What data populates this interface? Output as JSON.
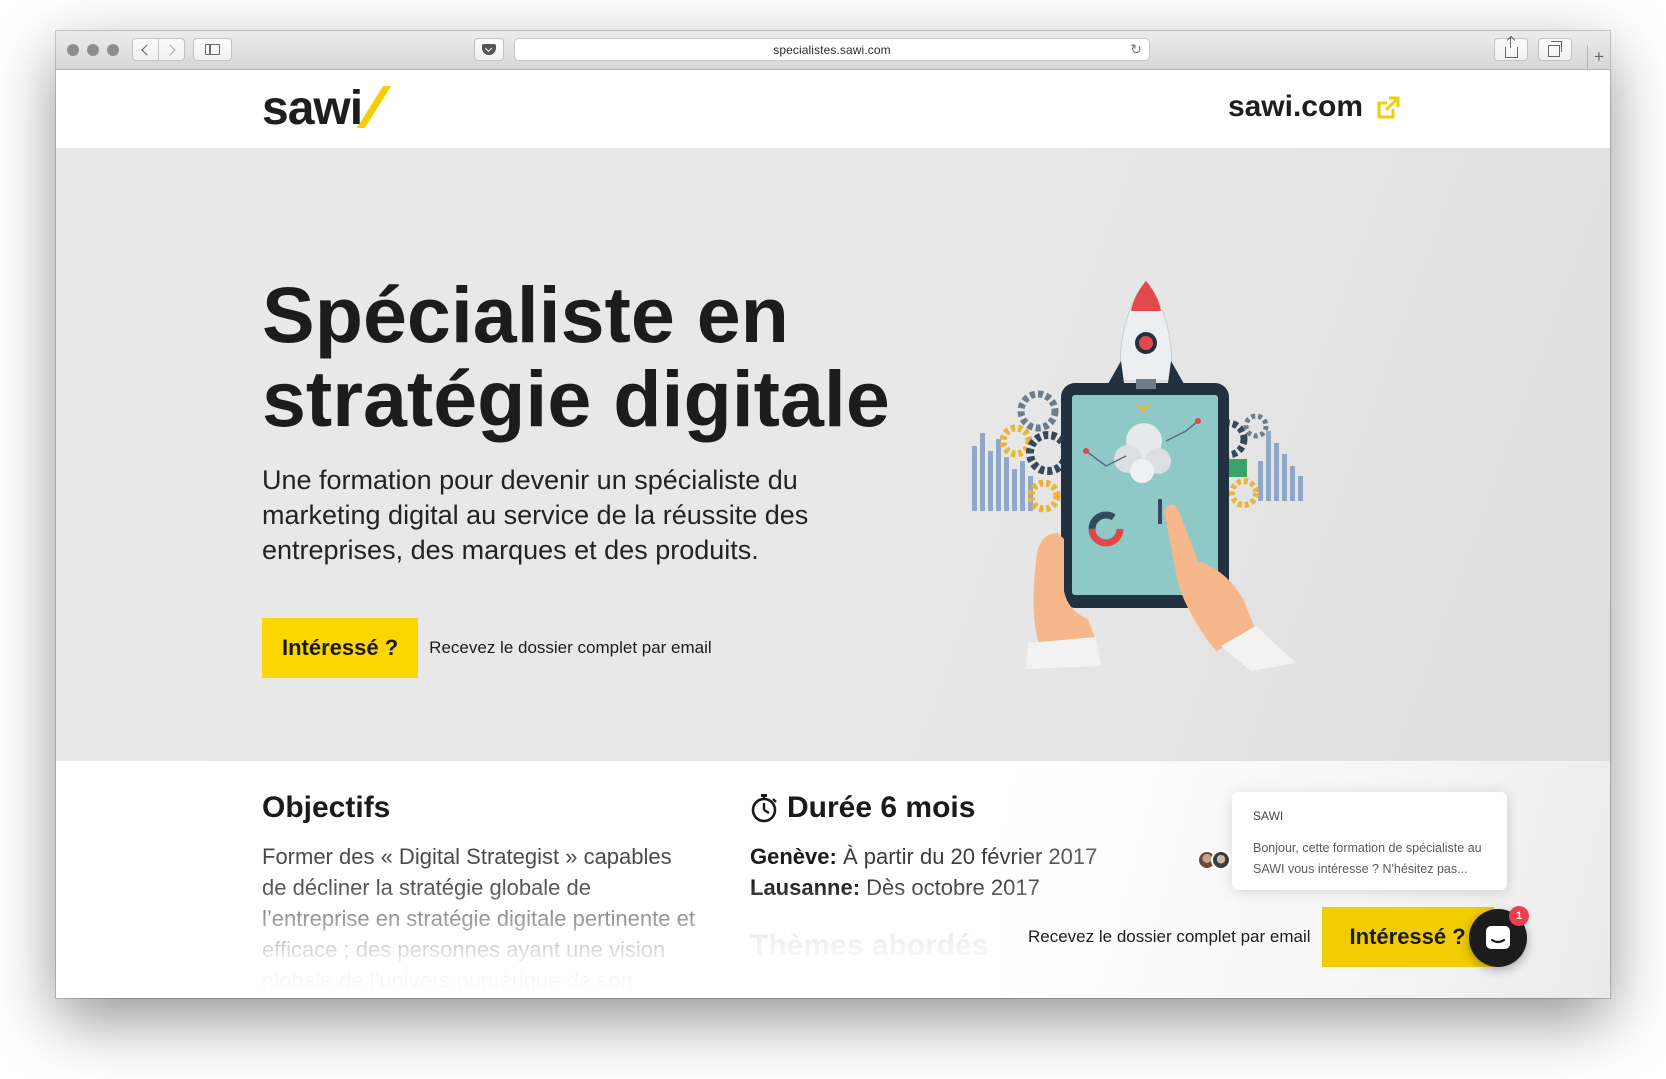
{
  "browser": {
    "url": "specialistes.sawi.com"
  },
  "header": {
    "logo_text": "sawi",
    "external_link": "sawi.com"
  },
  "hero": {
    "title": "Spécialiste en stratégie digitale",
    "subtitle": "Une formation pour devenir un spécialiste du marketing digital au service de la réussite des entreprises, des marques et des produits.",
    "cta_label": "Intéressé ?",
    "cta_note": "Recevez le dossier complet par email"
  },
  "objectifs": {
    "heading": "Objectifs",
    "text": "Former des « Digital Strategist » capables de décliner la stratégie globale de l’entreprise en stratégie digitale pertinente et efficace ; des personnes ayant une vision globale de l’univers numérique de son entreprise et de ses marques"
  },
  "duree": {
    "heading": "Durée 6 mois",
    "lines": [
      {
        "city": "Genève:",
        "text": "À partir du 20 février 2017"
      },
      {
        "city": "Lausanne:",
        "text": "Dès octobre 2017"
      }
    ],
    "themes_heading": "Thèmes abordés"
  },
  "chat": {
    "sender": "SAWI",
    "message": "Bonjour, cette formation de spécialiste au SAWI vous intéresse ? N'hésitez pas..."
  },
  "bottom_bar": {
    "note": "Recevez le dossier complet par email",
    "cta_label": "Intéressé ?"
  },
  "messenger": {
    "badge_count": "1"
  },
  "colors": {
    "brand_yellow": "#fcd600",
    "hero_bg": "#e8e8e8",
    "text_dark": "#1c1c1c"
  },
  "icons": [
    "back-icon",
    "forward-icon",
    "sidebar-icon",
    "pocket-icon",
    "reload-icon",
    "share-icon",
    "tabs-icon",
    "external-link-icon",
    "stopwatch-icon",
    "messenger-icon"
  ]
}
